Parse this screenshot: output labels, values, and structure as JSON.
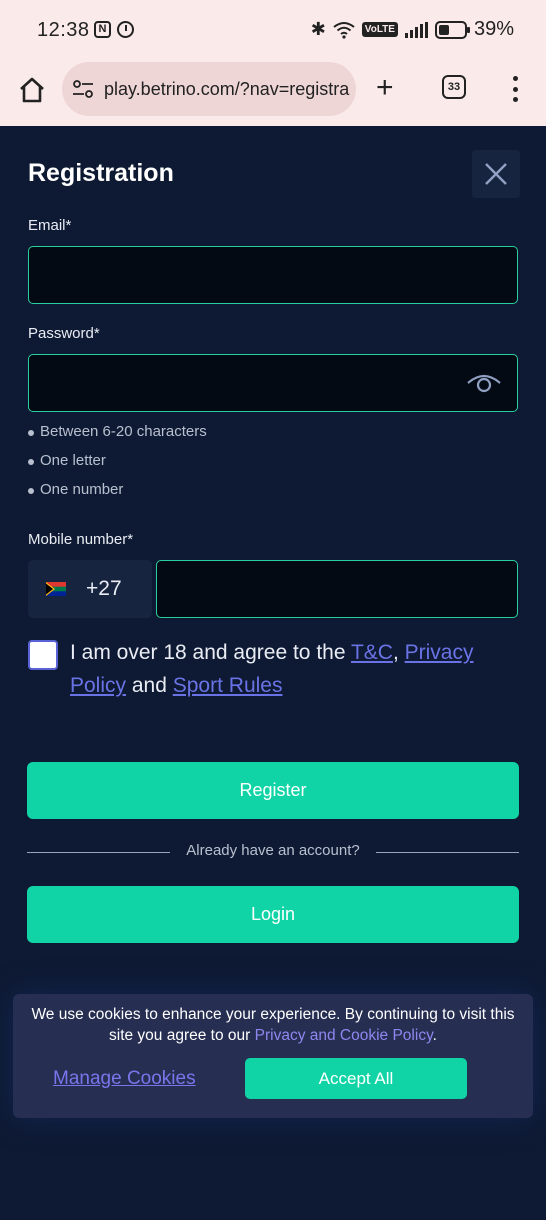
{
  "status_bar": {
    "time": "12:38",
    "battery": "39%",
    "volte": "VoLTE"
  },
  "browser": {
    "url": "play.betrino.com/?nav=registra",
    "tab_count": "33"
  },
  "modal": {
    "title": "Registration",
    "email_label": "Email*",
    "password_label": "Password*",
    "password_rules": [
      "Between 6-20 characters",
      "One letter",
      "One number"
    ],
    "mobile_label": "Mobile number*",
    "dial_code": "+27",
    "consent": {
      "text_before": "I am over 18 and agree to the ",
      "tc_link": "T&C",
      "comma": ", ",
      "privacy_link": "Privacy Policy",
      "and": " and ",
      "sport_rules_link": "Sport Rules"
    },
    "register_label": "Register",
    "divider_text": "Already have an account?",
    "login_label": "Login"
  },
  "cookie_banner": {
    "text": "We use cookies to enhance your experience. By continuing to visit this site you agree to our ",
    "policy_link": "Privacy and Cookie Policy",
    "period": ".",
    "manage_label": "Manage Cookies",
    "accept_label": "Accept All"
  },
  "colors": {
    "background": "#0e1a33",
    "accent": "#10d4a6",
    "input_border": "#2bcf9f",
    "link": "#6a73e6"
  }
}
